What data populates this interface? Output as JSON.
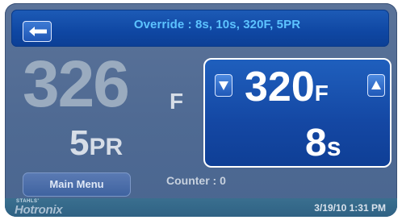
{
  "header": {
    "title": "Override : 8s, 10s, 320F, 5PR"
  },
  "actual": {
    "temperature": "326",
    "temperature_unit": "F",
    "pressure": "5",
    "pressure_unit": "PR"
  },
  "setpoint": {
    "temperature": "320",
    "temperature_unit": "F",
    "time": "8",
    "time_unit": "s"
  },
  "footer": {
    "main_menu_label": "Main Menu",
    "counter_text": "Counter : 0",
    "brand_small": "STAHLS'",
    "brand_name": "Hotronix",
    "datetime": "3/19/10  1:31 PM"
  },
  "icons": {
    "back": "back-arrow-icon",
    "down": "down-arrow-icon",
    "up": "up-arrow-icon"
  },
  "colors": {
    "background": "#5b7399",
    "header_blue": "#0f47a3",
    "title_cyan": "#5cc3ff",
    "setpoint_panel": "#1447a3"
  }
}
